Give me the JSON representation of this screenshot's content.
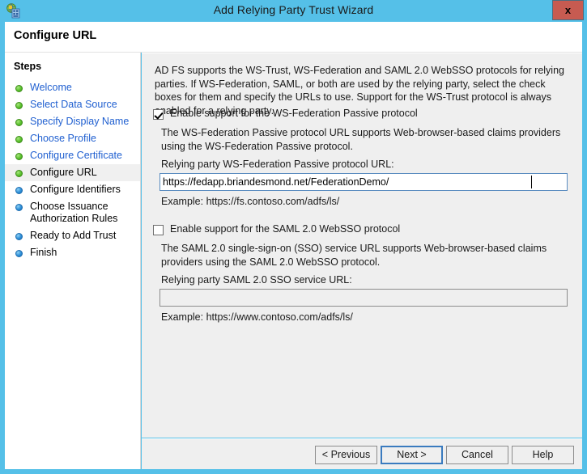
{
  "window": {
    "title": "Add Relying Party Trust Wizard",
    "icon": "adfs-wizard-icon",
    "close_label": "x",
    "accent_color": "#55C0E8",
    "close_button_color": "#C75B51"
  },
  "header": {
    "title": "Configure URL"
  },
  "sidebar": {
    "heading": "Steps",
    "items": [
      {
        "label": "Welcome",
        "state": "done"
      },
      {
        "label": "Select Data Source",
        "state": "done"
      },
      {
        "label": "Specify Display Name",
        "state": "done"
      },
      {
        "label": "Choose Profile",
        "state": "done"
      },
      {
        "label": "Configure Certificate",
        "state": "done"
      },
      {
        "label": "Configure URL",
        "state": "current"
      },
      {
        "label": "Configure Identifiers",
        "state": "upcoming"
      },
      {
        "label": "Choose Issuance Authorization Rules",
        "state": "upcoming"
      },
      {
        "label": "Ready to Add Trust",
        "state": "upcoming"
      },
      {
        "label": "Finish",
        "state": "upcoming"
      }
    ],
    "done_color": "#1F5FD0",
    "done_bullet_color": "#5BC22E",
    "upcoming_bullet_color": "#2E8FD8"
  },
  "content": {
    "intro": "AD FS supports the WS-Trust, WS-Federation and SAML 2.0 WebSSO protocols for relying parties.  If WS-Federation, SAML, or both are used by the relying party, select the check boxes for them and specify the URLs to use.  Support for the WS-Trust protocol is always enabled for a relying party.",
    "wsfed": {
      "checkbox_label": "Enable support for the WS-Federation Passive protocol",
      "checked": true,
      "description": "The WS-Federation Passive protocol URL supports Web-browser-based claims providers using the WS-Federation Passive protocol.",
      "field_label": "Relying party WS-Federation Passive protocol URL:",
      "value": "https://fedapp.briandesmond.net/FederationDemo/",
      "placeholder": "",
      "example": "Example: https://fs.contoso.com/adfs/ls/"
    },
    "saml": {
      "checkbox_label": "Enable support for the SAML 2.0 WebSSO protocol",
      "checked": false,
      "description": "The SAML 2.0 single-sign-on (SSO) service URL supports Web-browser-based claims providers using the SAML 2.0 WebSSO protocol.",
      "field_label": "Relying party SAML 2.0 SSO service URL:",
      "value": "",
      "placeholder": "",
      "example": "Example: https://www.contoso.com/adfs/ls/"
    }
  },
  "buttons": {
    "previous": "< Previous",
    "next": "Next >",
    "cancel": "Cancel",
    "help": "Help"
  }
}
